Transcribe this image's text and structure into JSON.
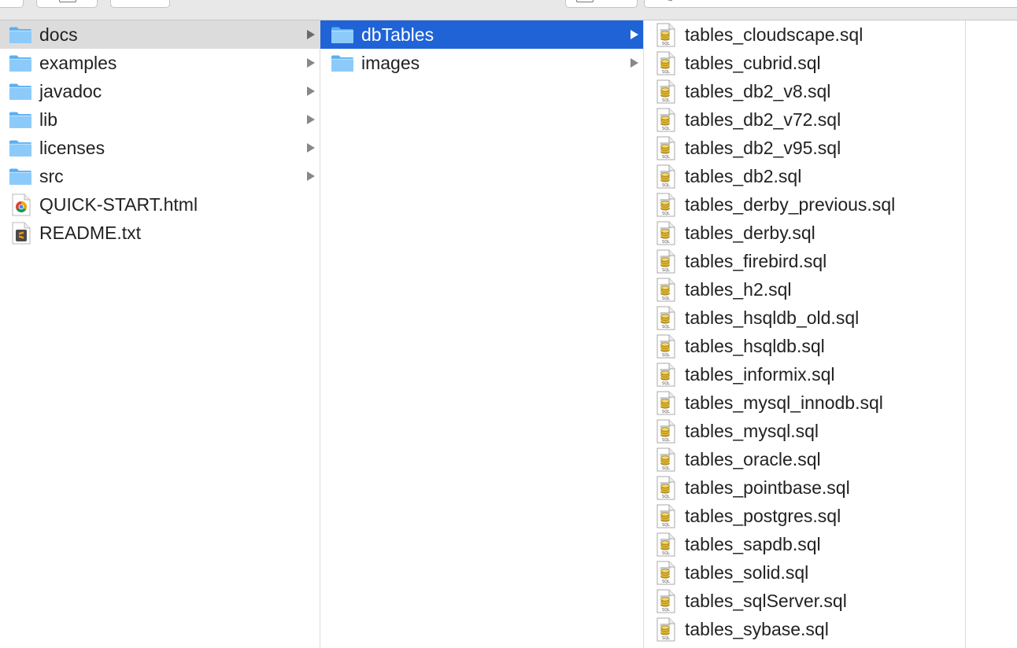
{
  "toolbar": {
    "buttons": [
      "view-button",
      "arrange-button",
      "action-button"
    ],
    "search_icon": "search-icon"
  },
  "columns": [
    {
      "items": [
        {
          "label": "docs",
          "type": "folder",
          "has_children": true,
          "selected": "inactive"
        },
        {
          "label": "examples",
          "type": "folder",
          "has_children": true
        },
        {
          "label": "javadoc",
          "type": "folder",
          "has_children": true
        },
        {
          "label": "lib",
          "type": "folder",
          "has_children": true
        },
        {
          "label": "licenses",
          "type": "folder",
          "has_children": true
        },
        {
          "label": "src",
          "type": "folder",
          "has_children": true
        },
        {
          "label": "QUICK-START.html",
          "type": "html",
          "icon": "chrome-document-icon"
        },
        {
          "label": "README.txt",
          "type": "txt",
          "icon": "sublime-document-icon"
        }
      ]
    },
    {
      "items": [
        {
          "label": "dbTables",
          "type": "folder",
          "has_children": true,
          "selected": "active"
        },
        {
          "label": "images",
          "type": "folder",
          "has_children": true
        }
      ]
    },
    {
      "items": [
        {
          "label": "tables_cloudscape.sql",
          "type": "sql"
        },
        {
          "label": "tables_cubrid.sql",
          "type": "sql"
        },
        {
          "label": "tables_db2_v8.sql",
          "type": "sql"
        },
        {
          "label": "tables_db2_v72.sql",
          "type": "sql"
        },
        {
          "label": "tables_db2_v95.sql",
          "type": "sql"
        },
        {
          "label": "tables_db2.sql",
          "type": "sql"
        },
        {
          "label": "tables_derby_previous.sql",
          "type": "sql"
        },
        {
          "label": "tables_derby.sql",
          "type": "sql"
        },
        {
          "label": "tables_firebird.sql",
          "type": "sql"
        },
        {
          "label": "tables_h2.sql",
          "type": "sql"
        },
        {
          "label": "tables_hsqldb_old.sql",
          "type": "sql"
        },
        {
          "label": "tables_hsqldb.sql",
          "type": "sql"
        },
        {
          "label": "tables_informix.sql",
          "type": "sql"
        },
        {
          "label": "tables_mysql_innodb.sql",
          "type": "sql"
        },
        {
          "label": "tables_mysql.sql",
          "type": "sql"
        },
        {
          "label": "tables_oracle.sql",
          "type": "sql"
        },
        {
          "label": "tables_pointbase.sql",
          "type": "sql"
        },
        {
          "label": "tables_postgres.sql",
          "type": "sql"
        },
        {
          "label": "tables_sapdb.sql",
          "type": "sql"
        },
        {
          "label": "tables_solid.sql",
          "type": "sql"
        },
        {
          "label": "tables_sqlServer.sql",
          "type": "sql"
        },
        {
          "label": "tables_sybase.sql",
          "type": "sql"
        }
      ]
    }
  ],
  "colors": {
    "selection_active": "#1f63d7",
    "selection_inactive": "#dcdcdc",
    "folder": "#6cb5f0",
    "text": "#222222"
  }
}
